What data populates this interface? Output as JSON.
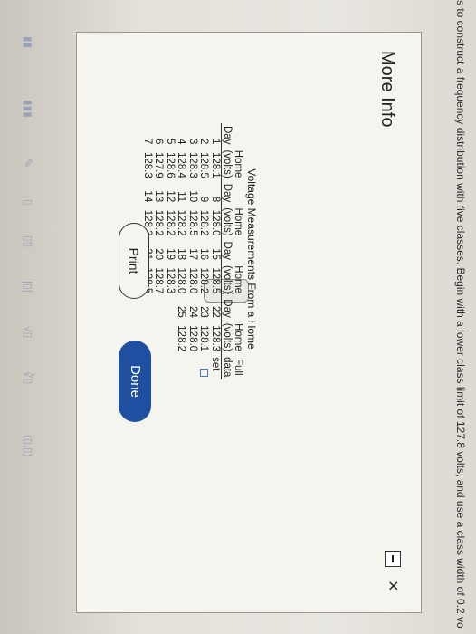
{
  "question": {
    "text": "s to construct a frequency distribution with five classes. Begin with a lower class limit of 127.8 volts, and use a class width of 0.2 vo"
  },
  "modal": {
    "title": "More Info",
    "close_glyph": "×",
    "print_label": "Print",
    "done_label": "Done"
  },
  "table": {
    "title": "Voltage Measurements From a Home",
    "headers": [
      [
        "Day",
        "Home (volts)"
      ],
      [
        "Day",
        "Home (volts)"
      ],
      [
        "Day",
        "Home (volts)"
      ],
      [
        "Day",
        "Home (volts)"
      ]
    ],
    "header_top": [
      "",
      "Home",
      "",
      "Home",
      "",
      "Home",
      "",
      "Home"
    ],
    "header_bottom": [
      "Day",
      "(volts)",
      "Day",
      "(volts)",
      "Day",
      "(volts)",
      "Day",
      "(volts)"
    ],
    "rows": [
      [
        "1",
        "128.1",
        "8",
        "128.0",
        "15",
        "128.5",
        "22",
        "128.3"
      ],
      [
        "2",
        "128.5",
        "9",
        "128.2",
        "16",
        "128.2",
        "23",
        "128.1"
      ],
      [
        "3",
        "128.3",
        "10",
        "128.5",
        "17",
        "128.0",
        "24",
        "128.0"
      ],
      [
        "4",
        "128.4",
        "11",
        "128.2",
        "18",
        "128.0",
        "25",
        "128.2"
      ],
      [
        "5",
        "128.6",
        "12",
        "128.2",
        "19",
        "128.3",
        "",
        ""
      ],
      [
        "6",
        "127.9",
        "13",
        "128.2",
        "20",
        "128.7",
        "",
        ""
      ],
      [
        "7",
        "128.3",
        "14",
        "128.3",
        "21",
        "128.5",
        "",
        ""
      ]
    ],
    "side_labels": [
      "Full",
      "data",
      "set"
    ]
  },
  "toolbar": {
    "icons": [
      "▮▮",
      "▮▮▮",
      "✎",
      "▯",
      "▯▯",
      "|▯|",
      "√▯",
      "∛▯",
      "(▯,▯)"
    ]
  }
}
